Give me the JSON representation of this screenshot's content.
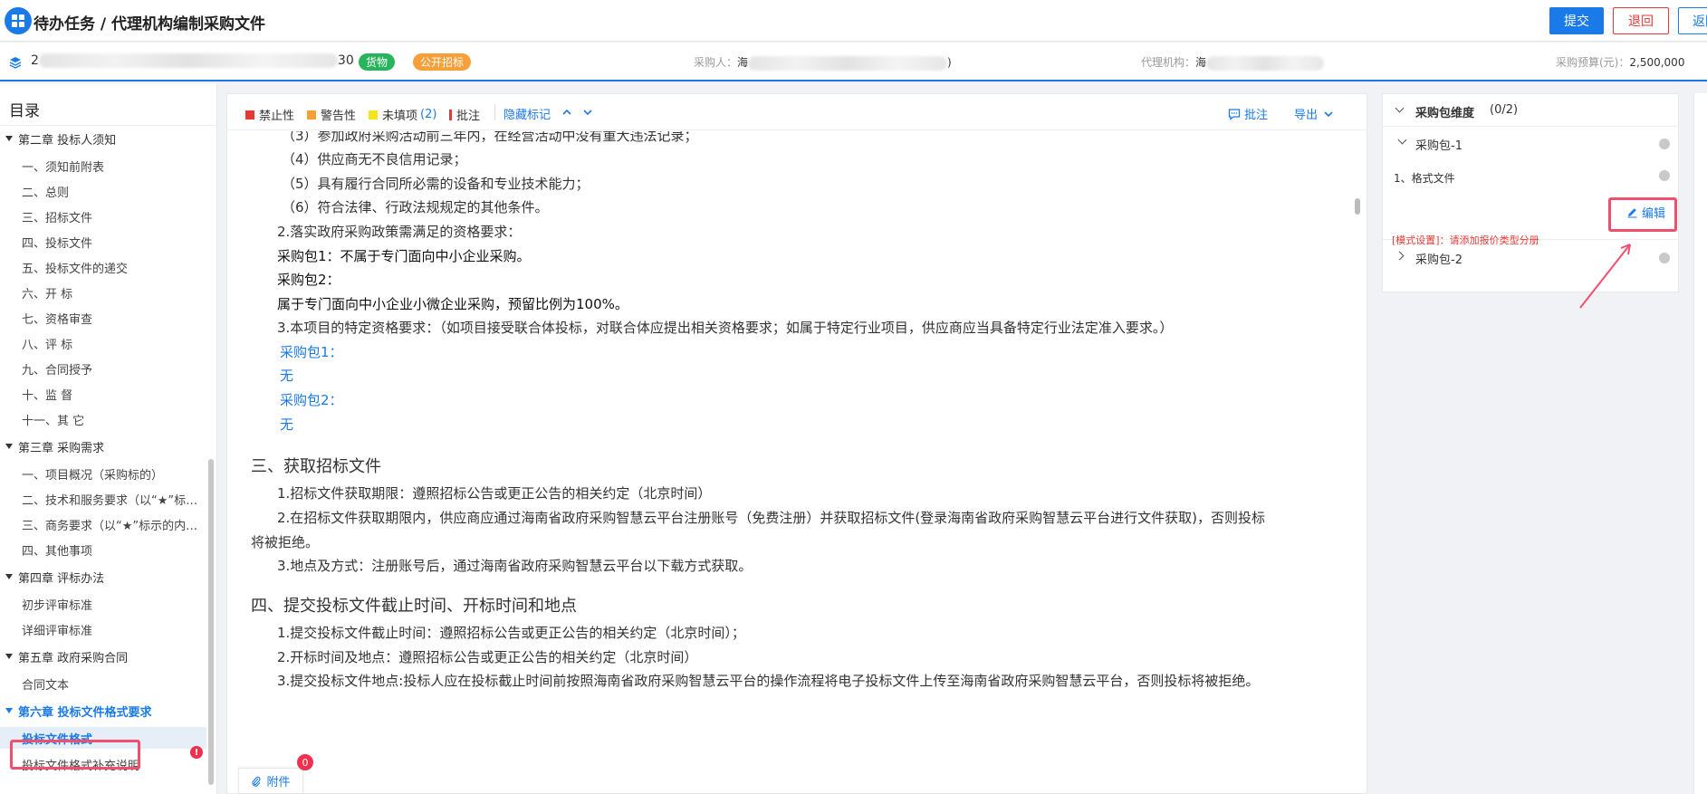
{
  "header": {
    "breadcrumb": "待办任务 / 代理机构编制采购文件",
    "submit_label": "提交",
    "return_label": "退回",
    "back_label": "返回"
  },
  "info": {
    "project_code_start": "2",
    "project_code_end": "30",
    "tag_goods": "货物",
    "tag_open": "公开招标",
    "purchaser_label": "采购人：",
    "purchaser_start": "海",
    "purchaser_end": ")",
    "agency_label": "代理机构：",
    "agency_start": "海",
    "budget_label": "采购预算(元)：",
    "budget_value": "2,500,000"
  },
  "sidebar": {
    "title": "目录",
    "items": [
      {
        "type": "chapter",
        "label": "第二章 投标人须知"
      },
      {
        "type": "section",
        "label": "一、须知前附表"
      },
      {
        "type": "section",
        "label": "二、总则"
      },
      {
        "type": "section",
        "label": "三、招标文件"
      },
      {
        "type": "section",
        "label": "四、投标文件"
      },
      {
        "type": "section",
        "label": "五、投标文件的递交"
      },
      {
        "type": "section",
        "label": "六、开 标"
      },
      {
        "type": "section",
        "label": "七、资格审查"
      },
      {
        "type": "section",
        "label": "八、评 标"
      },
      {
        "type": "section",
        "label": "九、合同授予"
      },
      {
        "type": "section",
        "label": "十、监 督"
      },
      {
        "type": "section",
        "label": "十一、其 它"
      },
      {
        "type": "chapter",
        "label": "第三章 采购需求"
      },
      {
        "type": "section",
        "label": "一、项目概况（采购标的）"
      },
      {
        "type": "section",
        "label": "二、技术和服务要求（以“★”标示的内容为实质性条款）"
      },
      {
        "type": "section",
        "label": "三、商务要求（以“★”标示的内容为实质性条款）"
      },
      {
        "type": "section",
        "label": "四、其他事项"
      },
      {
        "type": "chapter",
        "label": "第四章 评标办法"
      },
      {
        "type": "section",
        "label": "初步评审标准"
      },
      {
        "type": "section",
        "label": "详细评审标准"
      },
      {
        "type": "chapter",
        "label": "第五章 政府采购合同"
      },
      {
        "type": "section",
        "label": "合同文本"
      },
      {
        "type": "chapter",
        "label": "第六章 投标文件格式要求",
        "active": true
      },
      {
        "type": "section",
        "label": "投标文件格式",
        "selected": true
      },
      {
        "type": "section",
        "label": "投标文件格式补充说明"
      }
    ],
    "error_mark": "!"
  },
  "toolbar": {
    "legend_forbidden": "禁止性",
    "legend_warning": "警告性",
    "legend_unfilled": "未填项",
    "legend_unfilled_count": "(2)",
    "legend_comment": "批注",
    "hide_marks": "隐藏标记",
    "comment_btn": "批注",
    "export_btn": "导出",
    "colors": {
      "forbidden": "#e53935",
      "warning": "#f7a03a",
      "unfilled": "#f5e61c",
      "comment": "#e53935"
    }
  },
  "document": {
    "lines": [
      {
        "text": "（3）参加政府采购活动前三年内，在经营活动中没有重大违法记录；",
        "style": "normal"
      },
      {
        "text": "（4）供应商无不良信用记录；",
        "style": "normal"
      },
      {
        "text": "（5）具有履行合同所必需的设备和专业技术能力；",
        "style": "normal"
      },
      {
        "text": "（6）符合法律、行政法规规定的其他条件。",
        "style": "normal"
      },
      {
        "text": "2.落实政府采购政策需满足的资格要求：",
        "style": "normal"
      },
      {
        "text": "采购包1：不属于专门面向中小企业采购。",
        "style": "dark"
      },
      {
        "text": "采购包2：",
        "style": "dark"
      },
      {
        "text": "属于专门面向中小企业小微企业采购，预留比例为100%。",
        "style": "dark"
      },
      {
        "text": "3.本项目的特定资格要求：（如项目接受联合体投标，对联合体应提出相关资格要求；如属于特定行业项目，供应商应当具备特定行业法定准入要求。）",
        "style": "normal"
      },
      {
        "text": "采购包1：",
        "style": "blue"
      },
      {
        "text": "无",
        "style": "blue"
      },
      {
        "text": "采购包2：",
        "style": "blue"
      },
      {
        "text": "无",
        "style": "blue"
      },
      {
        "text": "三、获取招标文件",
        "style": "h3"
      },
      {
        "text": "1.招标文件获取期限：遵照招标公告或更正公告的相关约定（北京时间）",
        "style": "normal"
      },
      {
        "text": "2.在招标文件获取期限内，供应商应通过海南省政府采购智慧云平台注册账号（免费注册）并获取招标文件(登录海南省政府采购智慧云平台进行文件获取)，否则投标",
        "style": "normal"
      },
      {
        "text": "将被拒绝。",
        "style": "normal"
      },
      {
        "text": "3.地点及方式：注册账号后，通过海南省政府采购智慧云平台以下载方式获取。",
        "style": "normal"
      },
      {
        "text": "四、提交投标文件截止时间、开标时间和地点",
        "style": "h3"
      },
      {
        "text": "1.提交投标文件截止时间：遵照招标公告或更正公告的相关约定（北京时间）；",
        "style": "normal"
      },
      {
        "text": "2.开标时间及地点：遵照招标公告或更正公告的相关约定（北京时间）",
        "style": "normal"
      },
      {
        "text": "3.提交投标文件地点:投标人应在投标截止时间前按照海南省政府采购智慧云平台的操作流程将电子投标文件上传至海南省政府采购智慧云平台，否则投标将被拒绝。",
        "style": "normal"
      }
    ],
    "attachment_label": "附件",
    "attachment_count": "0"
  },
  "right_panel": {
    "title": "采购包维度",
    "count": "(0/2)",
    "package1": "采购包-1",
    "item1": "1、格式文件",
    "edit_label": "编辑",
    "warning": "[模式设置]：请添加报价类型分册",
    "package2": "采购包-2"
  },
  "colors": {
    "accent": "#1a7ae8",
    "danger": "#e53935",
    "highlight": "#f0506e"
  }
}
